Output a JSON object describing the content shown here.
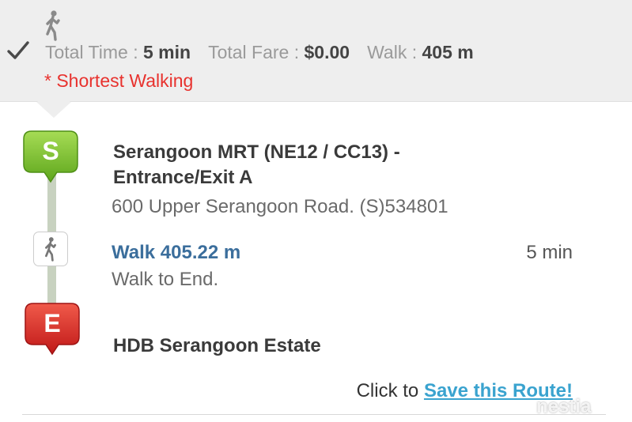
{
  "summary": {
    "total_time_label": "Total Time : ",
    "total_time_value": "5 min",
    "total_fare_label": "Total Fare : ",
    "total_fare_value": "$0.00",
    "walk_label": "Walk : ",
    "walk_value": "405 m",
    "route_tag": "* Shortest Walking"
  },
  "route": {
    "start": {
      "marker_letter": "S",
      "name": "Serangoon MRT (NE12 / CC13) - Entrance/Exit A",
      "address": "600 Upper Serangoon Road. (S)534801"
    },
    "walk_step": {
      "distance": "Walk 405.22 m",
      "duration": "5 min",
      "note": "Walk to End."
    },
    "end": {
      "marker_letter": "E",
      "name": "HDB Serangoon Estate"
    }
  },
  "actions": {
    "save_prefix": "Click to ",
    "save_link": "Save this Route!"
  },
  "watermark": "nestia",
  "icons": {
    "mode": "walking-person-icon",
    "selected": "check-icon",
    "start_marker": "start-marker-icon",
    "end_marker": "end-marker-icon"
  },
  "colors": {
    "start_marker": "#7cc12e",
    "end_marker": "#d42a2a",
    "shortest_tag": "#e8322e",
    "walk_link": "#3b6e9c",
    "save_link": "#3aa3cf",
    "summary_bg": "#eeeeee"
  }
}
